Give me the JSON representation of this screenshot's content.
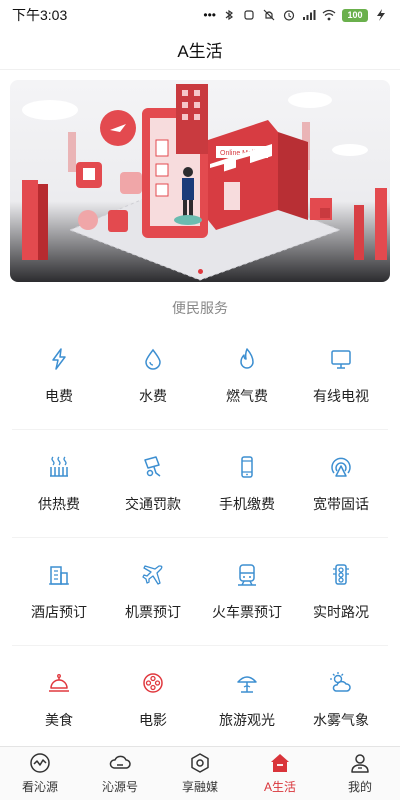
{
  "status_bar": {
    "time": "下午3:03",
    "battery": "100"
  },
  "header": {
    "title": "A生活"
  },
  "banner": {
    "sign_text": "Online Mall",
    "dots_count": 1
  },
  "section": {
    "title": "便民服务"
  },
  "services": [
    [
      {
        "label": "电费",
        "icon": "lightning-icon",
        "color": "#3d8fd1"
      },
      {
        "label": "水费",
        "icon": "water-drop-icon",
        "color": "#3d8fd1"
      },
      {
        "label": "燃气费",
        "icon": "flame-icon",
        "color": "#3d8fd1"
      },
      {
        "label": "有线电视",
        "icon": "tv-icon",
        "color": "#3d8fd1"
      }
    ],
    [
      {
        "label": "供热费",
        "icon": "heating-icon",
        "color": "#3d8fd1"
      },
      {
        "label": "交通罚款",
        "icon": "traffic-camera-icon",
        "color": "#3d8fd1"
      },
      {
        "label": "手机缴费",
        "icon": "mobile-phone-icon",
        "color": "#3d8fd1"
      },
      {
        "label": "宽带固话",
        "icon": "broadband-icon",
        "color": "#3d8fd1"
      }
    ],
    [
      {
        "label": "酒店预订",
        "icon": "hotel-icon",
        "color": "#3d8fd1"
      },
      {
        "label": "机票预订",
        "icon": "airplane-icon",
        "color": "#3d8fd1"
      },
      {
        "label": "火车票预订",
        "icon": "train-icon",
        "color": "#3d8fd1"
      },
      {
        "label": "实时路况",
        "icon": "traffic-light-icon",
        "color": "#3d8fd1"
      }
    ],
    [
      {
        "label": "美食",
        "icon": "food-cloche-icon",
        "color": "#e0383e"
      },
      {
        "label": "电影",
        "icon": "film-reel-icon",
        "color": "#e0383e"
      },
      {
        "label": "旅游观光",
        "icon": "beach-umbrella-icon",
        "color": "#3d8fd1"
      },
      {
        "label": "水雾气象",
        "icon": "weather-icon",
        "color": "#3d8fd1"
      }
    ]
  ],
  "bottom_nav": [
    {
      "label": "看沁源",
      "icon": "chart-wave-icon",
      "active": false
    },
    {
      "label": "沁源号",
      "icon": "cloud-icon",
      "active": false
    },
    {
      "label": "享融媒",
      "icon": "media-icon",
      "active": false
    },
    {
      "label": "A生活",
      "icon": "home-icon",
      "active": true
    },
    {
      "label": "我的",
      "icon": "user-icon",
      "active": false
    }
  ],
  "colors": {
    "accent": "#e0383e",
    "icon_blue": "#3d8fd1"
  }
}
